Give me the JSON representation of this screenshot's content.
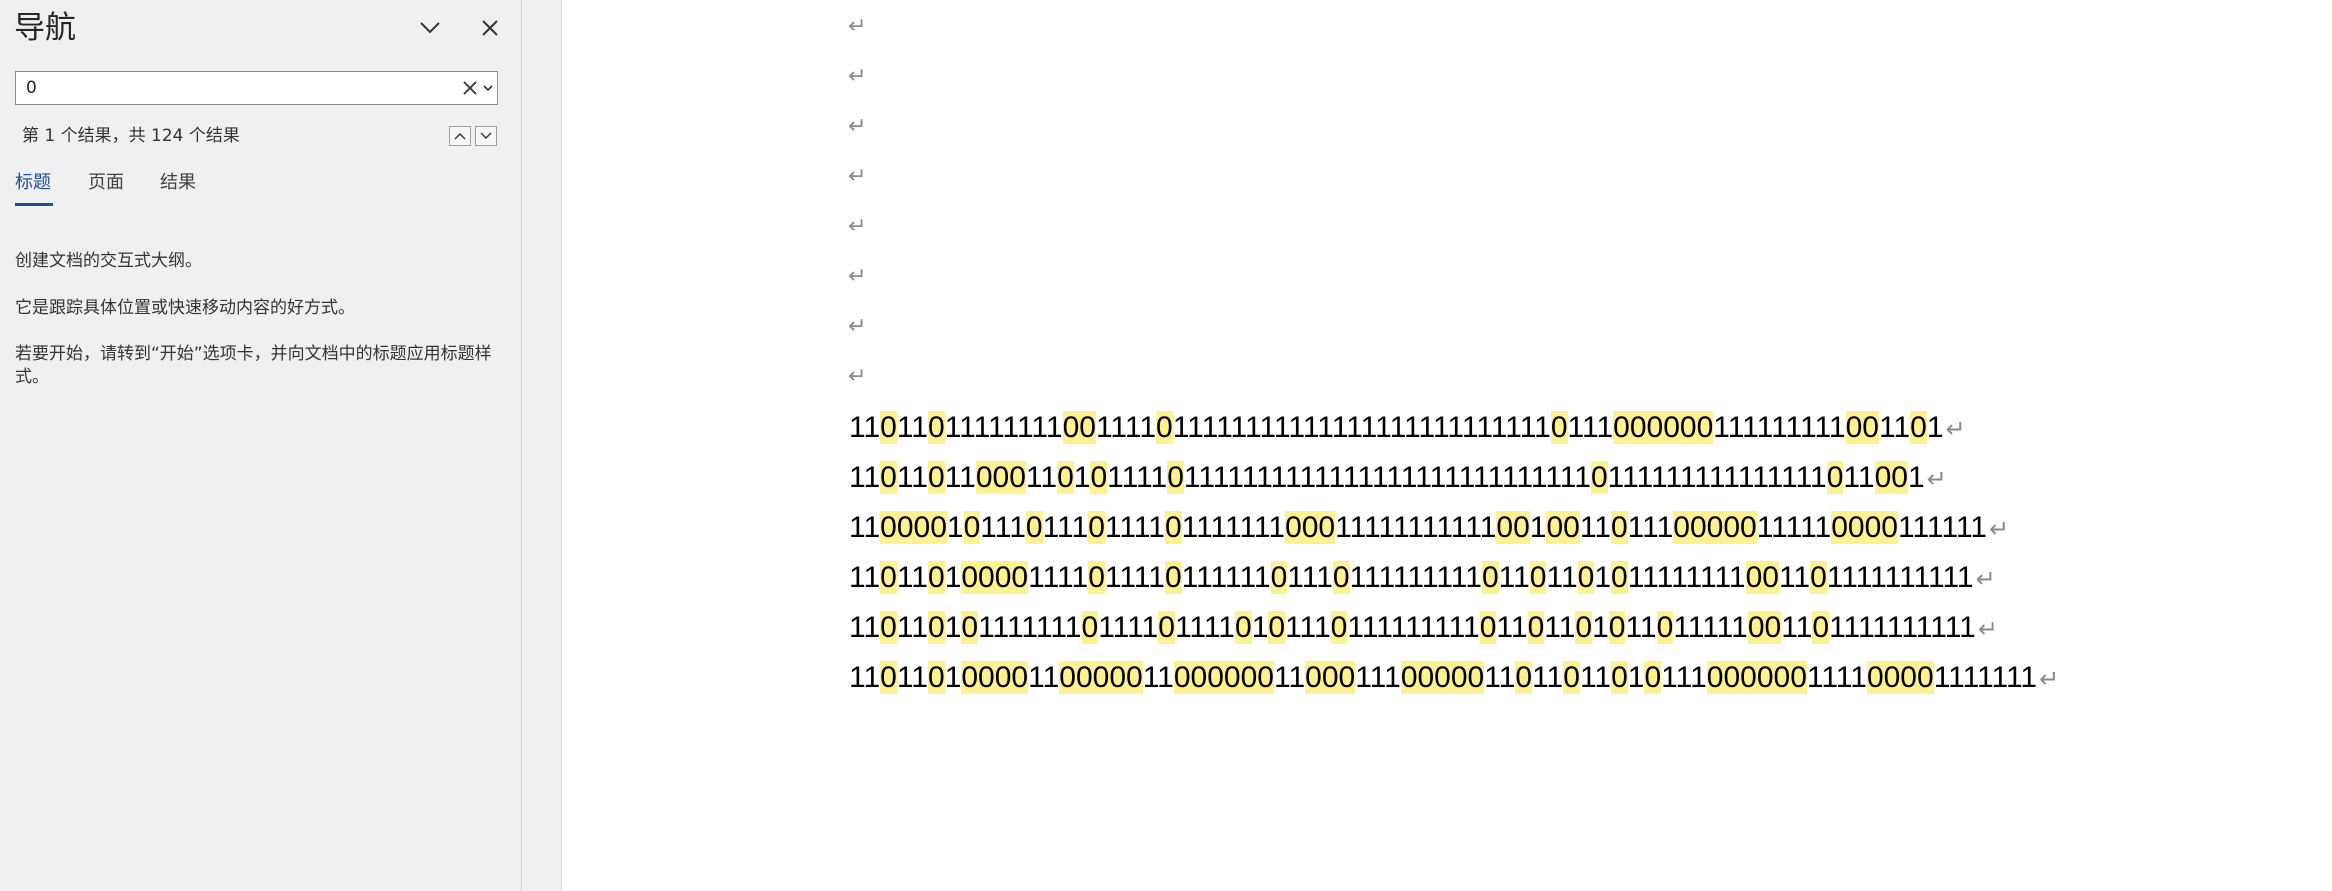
{
  "nav": {
    "title": "导航",
    "search_value": "0",
    "result_count": "第 1 个结果，共 124 个结果",
    "tabs": [
      "标题",
      "页面",
      "结果"
    ],
    "active_tab": "标题",
    "hint_lines": [
      "创建文档的交互式大纲。",
      "它是跟踪具体位置或快速移动内容的好方式。",
      "若要开始，请转到“开始”选项卡，并向文档中的标题应用标题样式。"
    ]
  },
  "document": {
    "paragraph_mark": "↵",
    "highlight_color": "#fef290",
    "highlight_term": "0",
    "lines": [
      "110110111111110011110111111111111111111111111110111000000111111111001101",
      "11011011000110101111011111111111111111111111111110111111111111111011001",
      "1100001011101110111101111111000111111111110010011011100000111110000111111",
      "1101101000011110111101111110111011111111101101101011111111001101111111111",
      "1101101011111110111101111010111011111111101101101011011111001101111111111",
      "11011010000110000011000000110001110000011011011010111000000111100001111111"
    ]
  }
}
